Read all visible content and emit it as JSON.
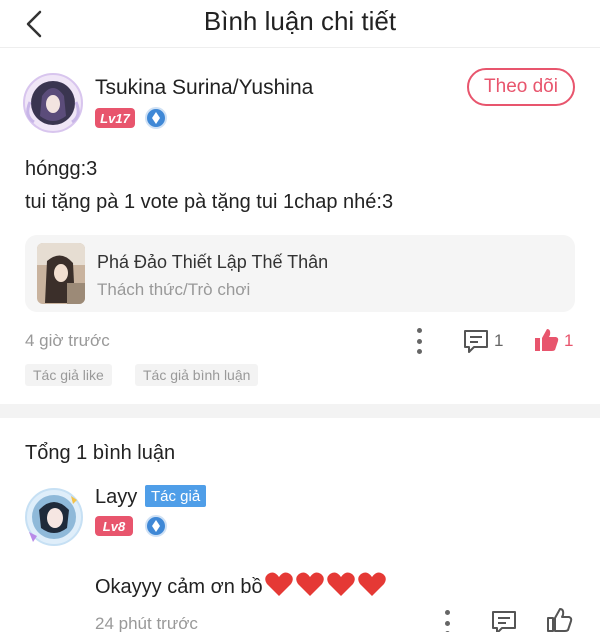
{
  "header": {
    "title": "Bình luận chi tiết"
  },
  "comment": {
    "author": "Tsukina Surina/Yushina",
    "level": "Lv17",
    "follow_label": "Theo dõi",
    "lines": [
      "hóngg:3",
      "tui tặng pà 1 vote pà tặng tui 1chap nhé:3"
    ],
    "time": "4 giờ trước",
    "reply_count": "1",
    "like_count": "1",
    "tags": [
      "Tác giả like",
      "Tác giả bình luận"
    ]
  },
  "story": {
    "title": "Phá Đảo Thiết Lập Thế Thân",
    "genre": "Thách thức/Trò chơi"
  },
  "replies": {
    "total_label": "Tổng 1 bình luận",
    "items": [
      {
        "name": "Layy",
        "badge": "Tác giả",
        "level": "Lv8",
        "text": "Okayyy cảm ơn bồ",
        "emoji_count": 4,
        "time": "24 phút trước"
      }
    ]
  },
  "colors": {
    "accent": "#e8556d",
    "author_badge": "#4f9ee8",
    "muted_text": "#999999",
    "card_bg": "#f5f5f5"
  },
  "icons": [
    "back-arrow-icon",
    "vip-diamond-icon",
    "more-vertical-icon",
    "comment-icon",
    "thumbs-up-icon",
    "heart-emoji-icon"
  ]
}
